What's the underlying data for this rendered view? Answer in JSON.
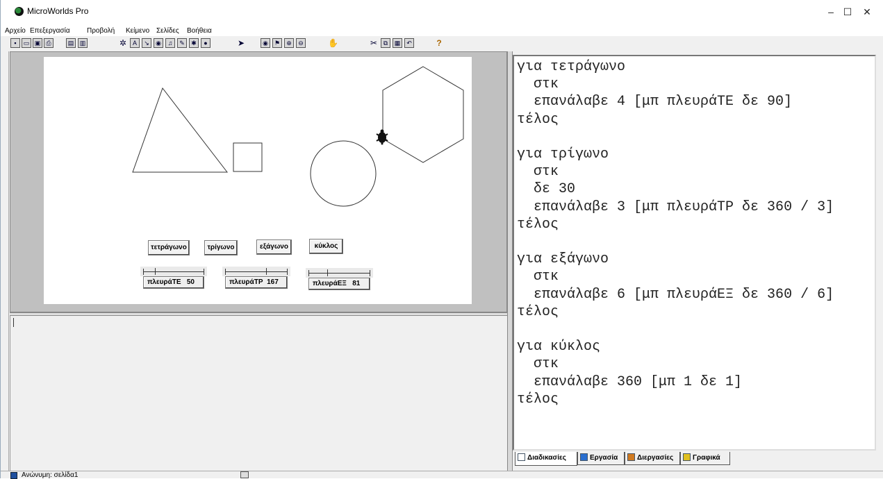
{
  "window": {
    "title": "MicroWorlds Pro",
    "controls": {
      "minimize": "–",
      "maximize": "☐",
      "close": "✕"
    }
  },
  "menu": [
    "Αρχείο",
    "Επεξεργασία",
    "Προβολή",
    "Κείμενο",
    "Σελίδες",
    "Βοήθεια"
  ],
  "toolbar": [
    "new-file-icon",
    "open-file-icon",
    "save-icon",
    "print-icon",
    "page-icon",
    "projector-icon",
    "turtle-icon",
    "text-box-icon",
    "button-tool-icon",
    "slider-tool-icon",
    "music-icon",
    "sound-icon",
    "video-icon",
    "web-icon",
    "pointer-icon",
    "eye-icon",
    "stamp-icon",
    "zoom-in-icon",
    "zoom-out-icon",
    "stop-icon",
    "cut-icon",
    "copy-icon",
    "paste-icon",
    "undo-icon",
    "help-icon"
  ],
  "buttons": [
    {
      "label": "τετράγωνο"
    },
    {
      "label": "τρίγωνο"
    },
    {
      "label": "εξάγωνο"
    },
    {
      "label": "κύκλος"
    }
  ],
  "sliders": [
    {
      "name": "πλευράΤΕ",
      "value": "50",
      "level": 0.2
    },
    {
      "name": "πλευράΤΡ",
      "value": "167",
      "level": 0.67
    },
    {
      "name": "πλευράΕΞ",
      "value": "81",
      "level": 0.32
    }
  ],
  "procedures": [
    "για τετράγωνο",
    "  στκ",
    "  επανάλαβε 4 [μπ πλευράΤΕ δε 90]",
    "τέλος",
    "",
    "για τρίγωνο",
    "  στκ",
    "  δε 30",
    "  επανάλαβε 3 [μπ πλευράΤΡ δε 360 / 3]",
    "τέλος",
    "",
    "για εξάγωνο",
    "  στκ",
    "  επανάλαβε 6 [μπ πλευράΕΞ δε 360 / 6]",
    "τέλος",
    "",
    "για κύκλος",
    "  στκ",
    "  επανάλαβε 360 [μπ 1 δε 1]",
    "τέλος"
  ],
  "tabs": [
    {
      "label": "Διαδικασίες",
      "active": true,
      "icon": "procedures-tab-icon",
      "color": "#ffffff"
    },
    {
      "label": "Εργασία",
      "active": false,
      "icon": "project-tab-icon",
      "color": "#2a6fd0"
    },
    {
      "label": "Διεργασίες",
      "active": false,
      "icon": "processes-tab-icon",
      "color": "#d07a20"
    },
    {
      "label": "Γραφικά",
      "active": false,
      "icon": "graphics-tab-icon",
      "color": "#e0c020"
    }
  ],
  "status": {
    "text": "Ανώνυμη: σελίδα1"
  }
}
